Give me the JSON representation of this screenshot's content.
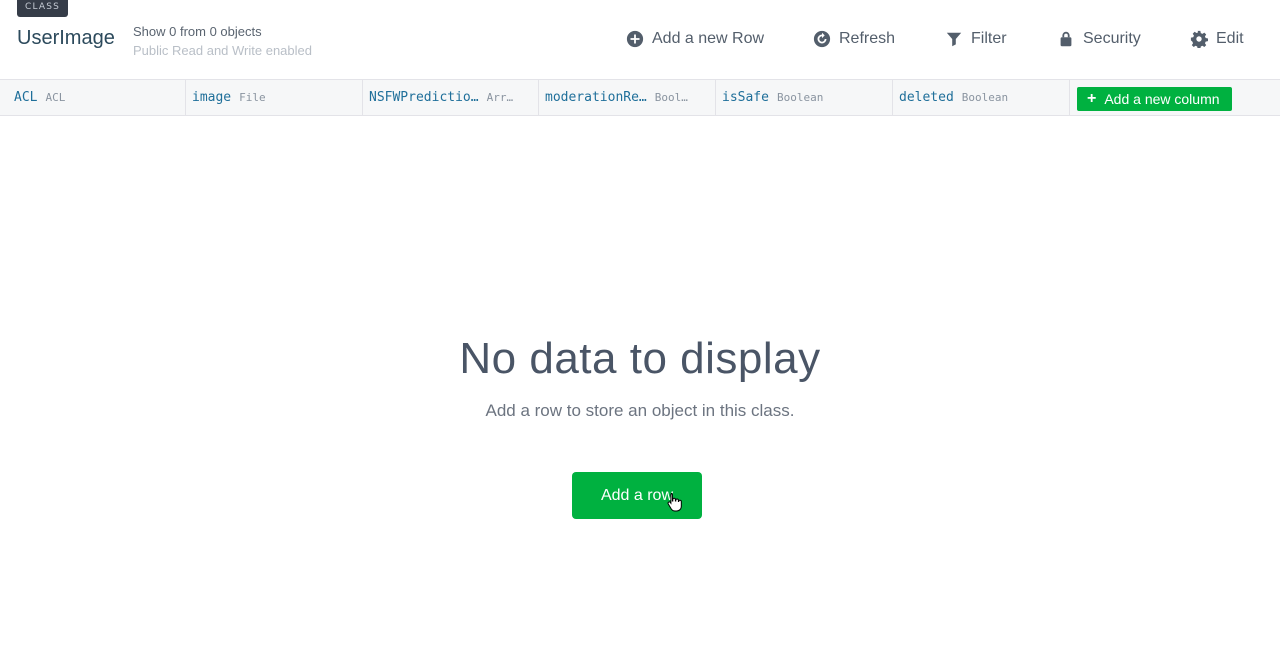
{
  "toolbar": {
    "class_tag": "CLASS",
    "class_name": "UserImage",
    "count_text": "Show 0 from 0 objects",
    "permission_text": "Public Read and Write enabled",
    "actions": [
      {
        "label": "Add a new Row",
        "icon": "plus-circle-icon"
      },
      {
        "label": "Refresh",
        "icon": "refresh-icon"
      },
      {
        "label": "Filter",
        "icon": "filter-icon"
      },
      {
        "label": "Security",
        "icon": "lock-icon"
      },
      {
        "label": "Edit",
        "icon": "gear-icon"
      }
    ]
  },
  "columns": [
    {
      "name": "ACL",
      "type": "ACL"
    },
    {
      "name": "image",
      "type": "File"
    },
    {
      "name": "NSFWPredictio…",
      "type": "Arr…"
    },
    {
      "name": "moderationRe…",
      "type": "Bool…"
    },
    {
      "name": "isSafe",
      "type": "Boolean"
    },
    {
      "name": "deleted",
      "type": "Boolean"
    }
  ],
  "add_column_label": "Add a new column",
  "empty_state": {
    "title": "No data to display",
    "description": "Add a row to store an object in this class.",
    "button_label": "Add a row"
  },
  "colors": {
    "accent_green": "#00b140",
    "column_name": "#1f6f9a",
    "tag_bg": "#353c48"
  }
}
